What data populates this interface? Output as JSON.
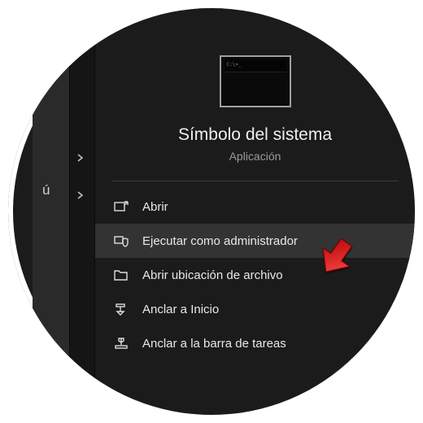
{
  "left": {
    "menuFragment": "ú"
  },
  "app": {
    "title": "Símbolo del sistema",
    "subtitle": "Aplicación"
  },
  "menu": {
    "open": "Abrir",
    "runAdmin": "Ejecutar como administrador",
    "openLocation": "Abrir ubicación de archivo",
    "pinStart": "Anclar a Inicio",
    "pinTaskbar": "Anclar a la barra de tareas"
  },
  "highlighted": "runAdmin"
}
